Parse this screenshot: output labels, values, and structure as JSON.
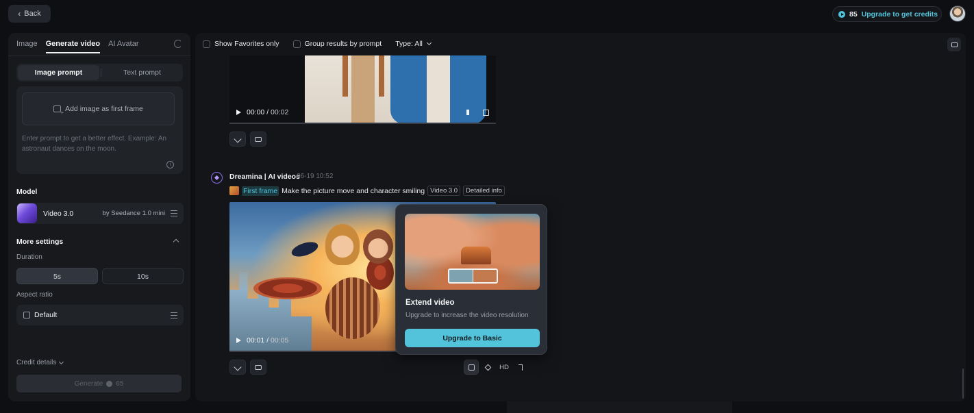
{
  "header": {
    "back_label": "Back",
    "credits_count": "85",
    "upgrade_credits_label": "Upgrade to get credits"
  },
  "sidebar": {
    "tabs": [
      {
        "label": "Image",
        "active": false
      },
      {
        "label": "Generate video",
        "active": true
      },
      {
        "label": "AI Avatar",
        "active": false
      }
    ],
    "prompt_mode": {
      "image": "Image prompt",
      "text": "Text prompt",
      "selected": "Image prompt"
    },
    "add_image_label": "Add image as first frame",
    "prompt_placeholder": "Enter prompt to get a better effect. Example: An astronaut dances on the moon.",
    "model_label": "Model",
    "model_name": "Video 3.0",
    "model_by": "by Seedance 1.0 mini",
    "more_settings_label": "More settings",
    "duration_label": "Duration",
    "duration_options": [
      "5s",
      "10s"
    ],
    "duration_selected": "5s",
    "aspect_label": "Aspect ratio",
    "aspect_value": "Default",
    "credit_details_label": "Credit details",
    "generate_label": "Generate",
    "generate_cost": "65"
  },
  "filters": {
    "favorites_label": "Show Favorites only",
    "group_label": "Group results by prompt",
    "type_label": "Type: All"
  },
  "video1": {
    "current_time": "00:00",
    "duration": "00:02"
  },
  "entry": {
    "name": "Dreamina | AI videos",
    "time": "06-19  10:52",
    "first_frame_label": "First frame",
    "prompt": "Make the picture move and character smiling",
    "model_tag": "Video 3.0",
    "details_tag": "Detailed info"
  },
  "video2": {
    "current_time": "00:01",
    "duration": "00:05"
  },
  "tools": {
    "hd_label": "HD"
  },
  "popover": {
    "title": "Extend video",
    "description": "Upgrade to increase the video resolution",
    "button_label": "Upgrade to Basic"
  },
  "colors": {
    "accent": "#52c3da",
    "background": "#0e0f12",
    "panel": "#17191d"
  },
  "icons": [
    "chevron-left-icon",
    "credit-coin-icon",
    "reset-icon",
    "add-image-icon",
    "info-icon",
    "sliders-icon",
    "chevron-up-icon",
    "aspect-square-icon",
    "chevron-down-icon",
    "folder-icon",
    "play-icon",
    "volume-icon",
    "fullscreen-icon",
    "edit-icon",
    "regenerate-icon",
    "dreamina-logo-icon",
    "extend-icon",
    "diamond-icon",
    "music-icon"
  ]
}
